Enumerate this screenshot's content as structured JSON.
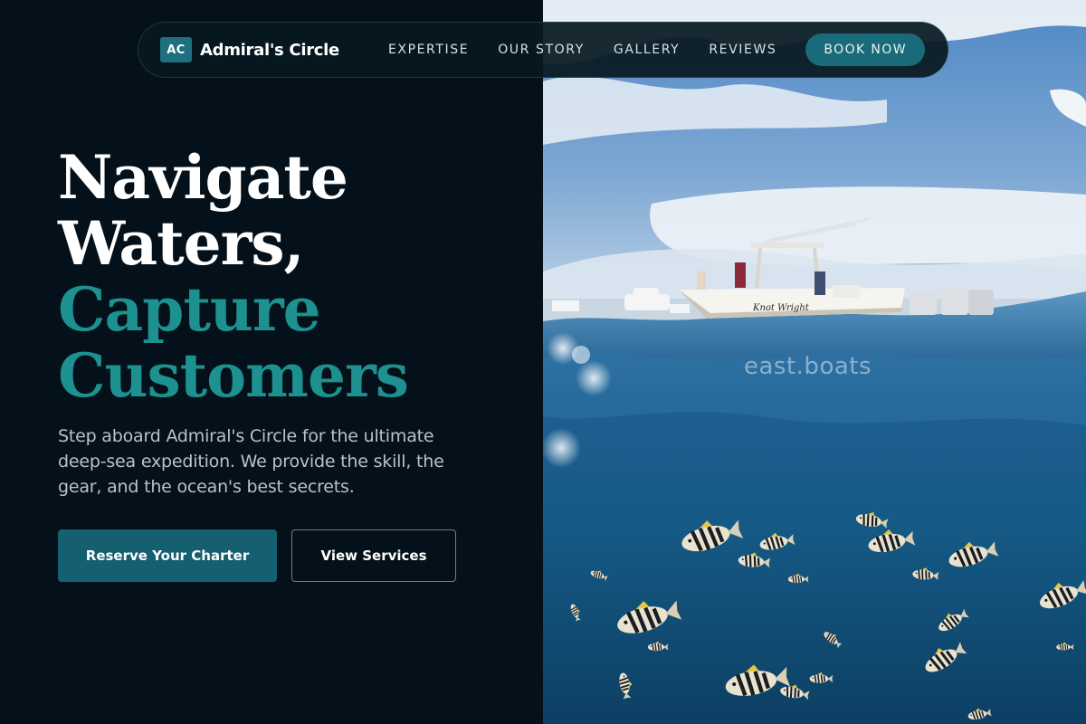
{
  "brand": {
    "logo_text": "AC",
    "name": "Admiral's Circle"
  },
  "nav": {
    "items": [
      {
        "label": "EXPERTISE"
      },
      {
        "label": "OUR STORY"
      },
      {
        "label": "GALLERY"
      },
      {
        "label": "REVIEWS"
      }
    ],
    "cta_label": "BOOK NOW"
  },
  "hero": {
    "headline_line1": "Navigate",
    "headline_line2": "Waters,",
    "headline_line3": "Capture",
    "headline_line4": "Customers",
    "lead": "Step aboard Admiral's Circle for the ultimate deep-sea expedition. We provide the skill, the gear, and the ocean's best secrets.",
    "primary_button": "Reserve Your Charter",
    "secondary_button": "View Services",
    "image_watermark": "east.boats",
    "boat_hull_text": "Knot Wright"
  },
  "colors": {
    "background": "#04111a",
    "accent_teal": "#1d9190",
    "button_teal": "#145f70",
    "ocean_deep": "#0e4a74"
  }
}
